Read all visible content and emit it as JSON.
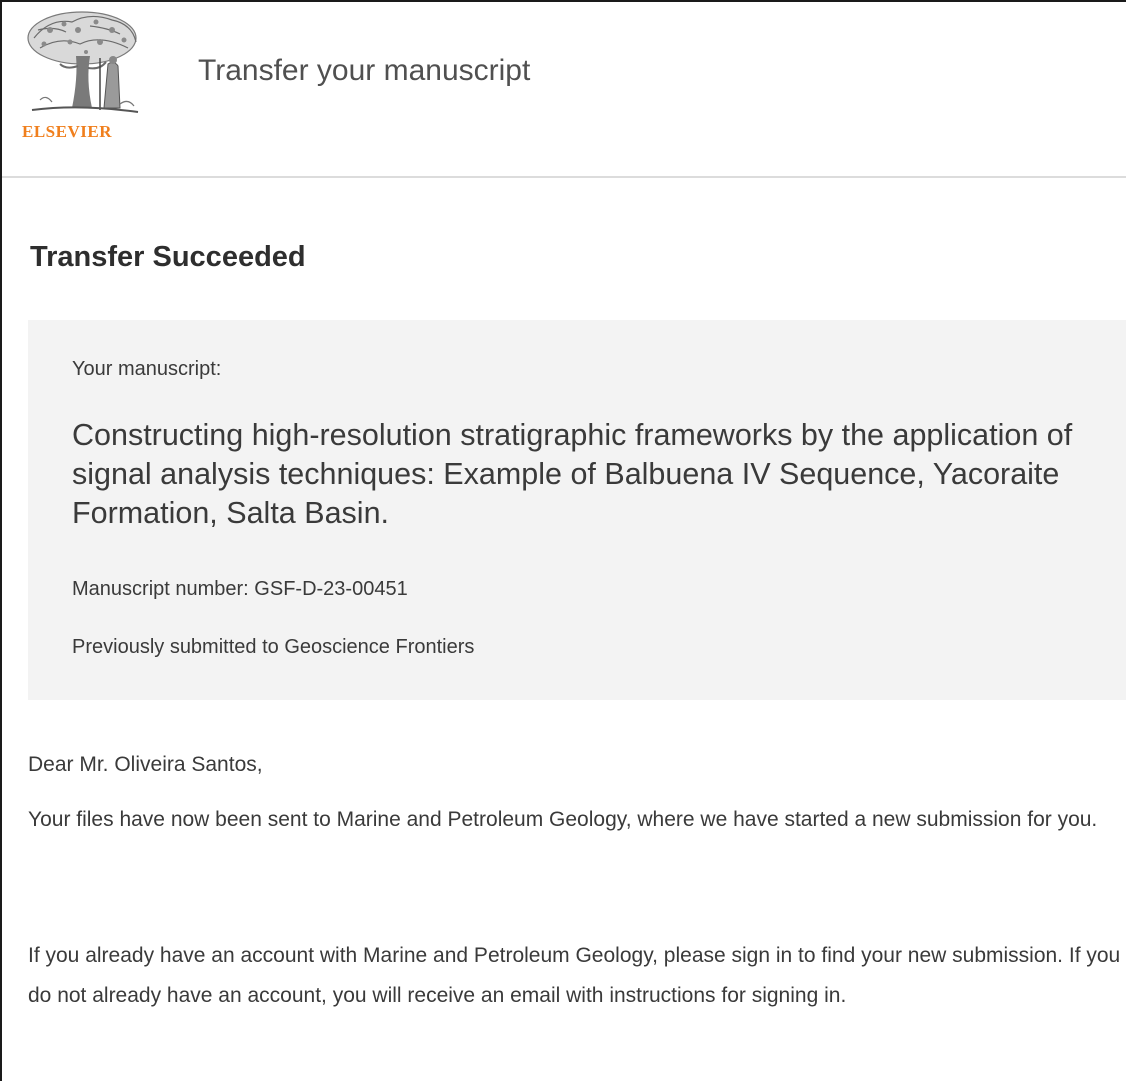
{
  "header": {
    "logo_text": "ELSEVIER",
    "title": "Transfer your manuscript"
  },
  "main": {
    "heading": "Transfer Succeeded",
    "manuscript": {
      "label": "Your manuscript:",
      "title": "Constructing high-resolution stratigraphic frameworks by the application of signal analysis techniques: Example of Balbuena IV Sequence, Yacoraite Formation, Salta Basin.",
      "number": "Manuscript number: GSF-D-23-00451",
      "previous": "Previously submitted to Geoscience Frontiers"
    },
    "greeting": "Dear Mr. Oliveira Santos,",
    "paragraph_1": "Your files have now been sent to Marine and Petroleum Geology, where we have started a new submission for you.",
    "paragraph_2": "If you already have an account with Marine and Petroleum Geology, please sign in to find your new submission. If you do not already have an account, you will receive an email with instructions for signing in."
  },
  "colors": {
    "logo_orange": "#f07f1d",
    "panel_background": "#f3f3f3",
    "text": "#3a3a3a"
  }
}
